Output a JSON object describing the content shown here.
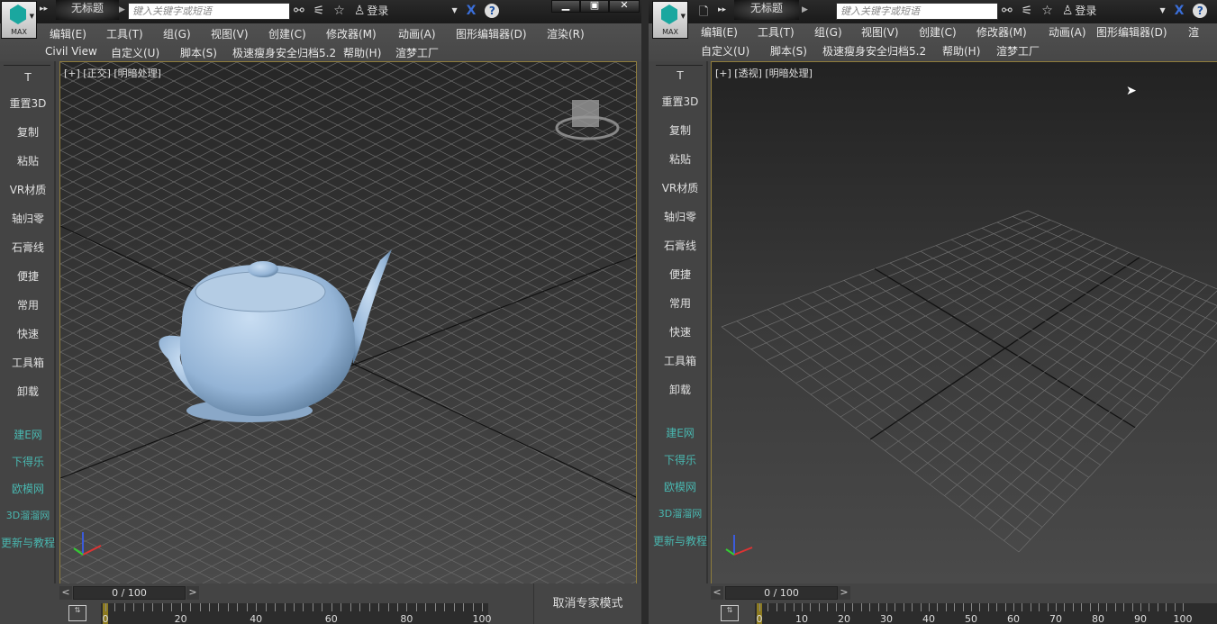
{
  "left_window": {
    "logo_label": "MAX",
    "title": "无标题",
    "search_placeholder": "键入关键字或短语",
    "login": "登录",
    "menu_row1": [
      "编辑(E)",
      "工具(T)",
      "组(G)",
      "视图(V)",
      "创建(C)",
      "修改器(M)",
      "动画(A)",
      "图形编辑器(D)",
      "渲染(R)"
    ],
    "menu_row2": [
      "Civil View",
      "自定义(U)",
      "脚本(S)",
      "极速瘦身安全归档5.2",
      "帮助(H)",
      "渲梦工厂"
    ],
    "viewport_label": "[+] [正交] [明暗处理]",
    "frame_counter": "0 / 100",
    "timeline_labels": [
      "0",
      "20",
      "40",
      "60",
      "80",
      "100"
    ],
    "expert_mode_button": "取消专家模式"
  },
  "right_window": {
    "logo_label": "MAX",
    "title": "无标题",
    "search_placeholder": "键入关键字或短语",
    "login": "登录",
    "menu_row1": [
      "编辑(E)",
      "工具(T)",
      "组(G)",
      "视图(V)",
      "创建(C)",
      "修改器(M)",
      "动画(A)",
      "图形编辑器(D)",
      "渲"
    ],
    "menu_row2": [
      "自定义(U)",
      "脚本(S)",
      "极速瘦身安全归档5.2",
      "帮助(H)",
      "渲梦工厂"
    ],
    "viewport_label": "[+] [透视] [明暗处理]",
    "frame_counter": "0 / 100",
    "timeline_labels": [
      "0",
      "10",
      "20",
      "30",
      "40",
      "50",
      "60",
      "70",
      "80",
      "90",
      "100"
    ]
  },
  "sidebar": {
    "items": [
      "T",
      "重置3D",
      "复制",
      "粘贴",
      "VR材质",
      "轴归零",
      "石膏线",
      "便捷",
      "常用",
      "快速",
      "工具箱",
      "卸载"
    ],
    "links": [
      "建E网",
      "下得乐",
      "欧模网",
      "3D溜溜网",
      "更新与教程"
    ]
  },
  "colors": {
    "teal_link": "#49b7b0",
    "viewport_border": "#8f7d3c",
    "teapot": "#9fbfe0"
  }
}
